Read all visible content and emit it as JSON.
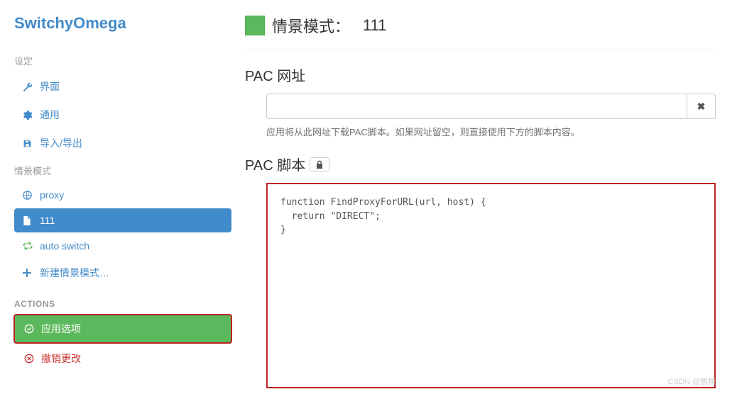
{
  "brand": "SwitchyOmega",
  "sidebar": {
    "settings_title": "设定",
    "items": [
      {
        "label": "界面"
      },
      {
        "label": "通用"
      },
      {
        "label": "导入/导出"
      }
    ],
    "profiles_title": "情景模式",
    "profiles": [
      {
        "label": "proxy"
      },
      {
        "label": "111"
      },
      {
        "label": "auto switch"
      }
    ],
    "new_profile": "新建情景模式…",
    "actions_title": "ACTIONS",
    "apply_label": "应用选项",
    "revert_label": "撤销更改"
  },
  "main": {
    "header_label": "情景模式：",
    "profile_name": "111",
    "pac_url_title": "PAC 网址",
    "pac_url_value": "",
    "pac_url_help": "应用将从此网址下载PAC脚本。如果网址留空，则直接使用下方的脚本内容。",
    "pac_script_title": "PAC 脚本",
    "pac_script": "function FindProxyForURL(url, host) {\n  return \"DIRECT\";\n}"
  },
  "watermark": "CSDN @颤楝"
}
